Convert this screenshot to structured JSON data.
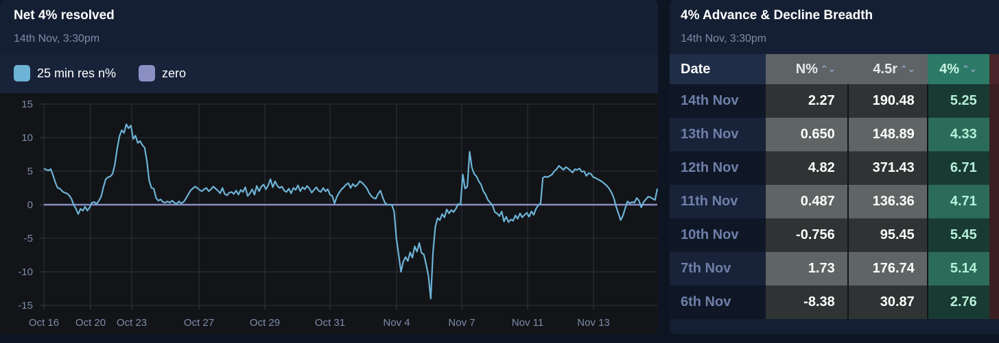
{
  "left_panel": {
    "title": "Net 4% resolved",
    "subtitle": "14th Nov, 3:30pm",
    "legend": [
      {
        "label": "25 min res n%",
        "color": "#6db3d6"
      },
      {
        "label": "zero",
        "color": "#8c8fc4"
      }
    ]
  },
  "chart_data": {
    "type": "line",
    "title": "Net 4% resolved",
    "ylim": [
      -15,
      15
    ],
    "yticks": [
      15,
      10,
      5,
      0,
      -5,
      -10,
      -15
    ],
    "xticks": [
      "Oct 16",
      "Oct 20",
      "Oct 23",
      "Oct 27",
      "Oct 29",
      "Oct 31",
      "Nov 4",
      "Nov 7",
      "Nov 11",
      "Nov 13"
    ],
    "grid": true,
    "series": [
      {
        "name": "25 min res n%",
        "color": "#6db3d6",
        "values": [
          5.4,
          5.2,
          5.1,
          5.3,
          4.4,
          3.3,
          2.5,
          2.4,
          2.0,
          1.8,
          1.7,
          1.4,
          0.9,
          0.0,
          -0.6,
          -1.4,
          -0.6,
          -0.9,
          -0.3,
          -0.9,
          -0.4,
          0.3,
          0.4,
          0.1,
          0.6,
          1.2,
          2.6,
          3.8,
          4.1,
          4.2,
          4.6,
          6.0,
          8.3,
          10.2,
          11.1,
          10.7,
          12.0,
          11.4,
          11.8,
          9.8,
          10.3,
          9.2,
          9.5,
          8.9,
          8.5,
          6.5,
          3.6,
          2.5,
          2.4,
          1.0,
          0.6,
          0.8,
          0.4,
          0.3,
          0.5,
          0.3,
          0.6,
          0.3,
          0.1,
          0.5,
          0.2,
          0.4,
          0.9,
          1.5,
          2.1,
          2.4,
          2.7,
          2.5,
          2.2,
          2.0,
          2.3,
          2.5,
          2.0,
          2.3,
          2.7,
          2.4,
          2.1,
          1.7,
          2.5,
          1.6,
          1.4,
          1.8,
          1.9,
          1.6,
          2.1,
          1.5,
          2.2,
          1.9,
          2.6,
          1.3,
          1.7,
          2.3,
          1.5,
          2.8,
          2.0,
          2.7,
          3.0,
          2.3,
          2.9,
          3.8,
          2.6,
          3.5,
          2.8,
          2.5,
          2.7,
          2.1,
          1.9,
          2.4,
          1.7,
          2.5,
          2.2,
          2.9,
          2.0,
          2.6,
          2.3,
          2.8,
          2.4,
          1.8,
          2.2,
          2.6,
          2.1,
          1.9,
          2.5,
          2.0,
          2.3,
          1.5,
          1.3,
          0.2,
          1.2,
          1.8,
          2.3,
          2.6,
          3.0,
          3.2,
          2.5,
          3.1,
          2.7,
          3.0,
          3.5,
          3.3,
          2.9,
          2.5,
          1.8,
          1.3,
          1.0,
          0.9,
          1.6,
          2.1,
          1.1,
          0.3,
          0.0,
          0.0,
          0.0,
          -1.0,
          -5.0,
          -7.5,
          -10.0,
          -8.5,
          -7.8,
          -8.4,
          -7.1,
          -7.9,
          -6.2,
          -7.0,
          -5.7,
          -7.2,
          -7.4,
          -8.9,
          -10.6,
          -14.0,
          -7.1,
          -3.3,
          -2.0,
          -2.3,
          -1.4,
          -1.9,
          -0.7,
          -1.3,
          -0.8,
          -1.1,
          -0.6,
          0.1,
          0.0,
          4.5,
          2.4,
          2.7,
          7.9,
          5.5,
          4.6,
          4.2,
          3.5,
          3.0,
          2.0,
          1.5,
          0.7,
          0.3,
          -0.1,
          -1.1,
          -1.3,
          -1.7,
          -1.0,
          -2.5,
          -1.8,
          -2.6,
          -2.2,
          -2.4,
          -1.6,
          -2.1,
          -1.3,
          -1.9,
          -1.5,
          -1.2,
          -1.8,
          -1.0,
          -1.5,
          -0.6,
          -0.1,
          0.2,
          4.0,
          4.2,
          4.1,
          4.3,
          4.5,
          5.0,
          5.3,
          5.8,
          5.5,
          5.2,
          5.6,
          5.4,
          5.1,
          4.8,
          5.3,
          5.2,
          5.4,
          4.9,
          5.0,
          4.3,
          4.7,
          4.6,
          4.1,
          4.0,
          3.8,
          3.6,
          3.4,
          3.1,
          2.8,
          2.4,
          1.8,
          1.0,
          -0.3,
          -1.3,
          -2.3,
          -1.6,
          -0.5,
          0.5,
          0.2,
          0.4,
          0.3,
          1.0,
          0.6,
          -0.4,
          0.4,
          0.8,
          1.2,
          1.1,
          0.9,
          0.7,
          2.4
        ]
      },
      {
        "name": "zero",
        "color": "#8c8fc4",
        "values": [
          0
        ]
      }
    ]
  },
  "right_panel": {
    "title": "4% Advance & Decline Breadth",
    "subtitle": "14th Nov, 3:30pm",
    "columns": [
      "Date",
      "N%",
      "4.5r",
      "4%"
    ],
    "sort_icon": "⌃⌄",
    "rows": [
      {
        "date": "14th Nov",
        "n": "2.27",
        "r": "190.48",
        "p4": "5.25"
      },
      {
        "date": "13th Nov",
        "n": "0.650",
        "r": "148.89",
        "p4": "4.33"
      },
      {
        "date": "12th Nov",
        "n": "4.82",
        "r": "371.43",
        "p4": "6.71"
      },
      {
        "date": "11th Nov",
        "n": "0.487",
        "r": "136.36",
        "p4": "4.71"
      },
      {
        "date": "10th Nov",
        "n": "-0.756",
        "r": "95.45",
        "p4": "5.45"
      },
      {
        "date": "7th Nov",
        "n": "1.73",
        "r": "176.74",
        "p4": "5.14"
      },
      {
        "date": "6th Nov",
        "n": "-8.38",
        "r": "30.87",
        "p4": "2.76"
      }
    ]
  }
}
